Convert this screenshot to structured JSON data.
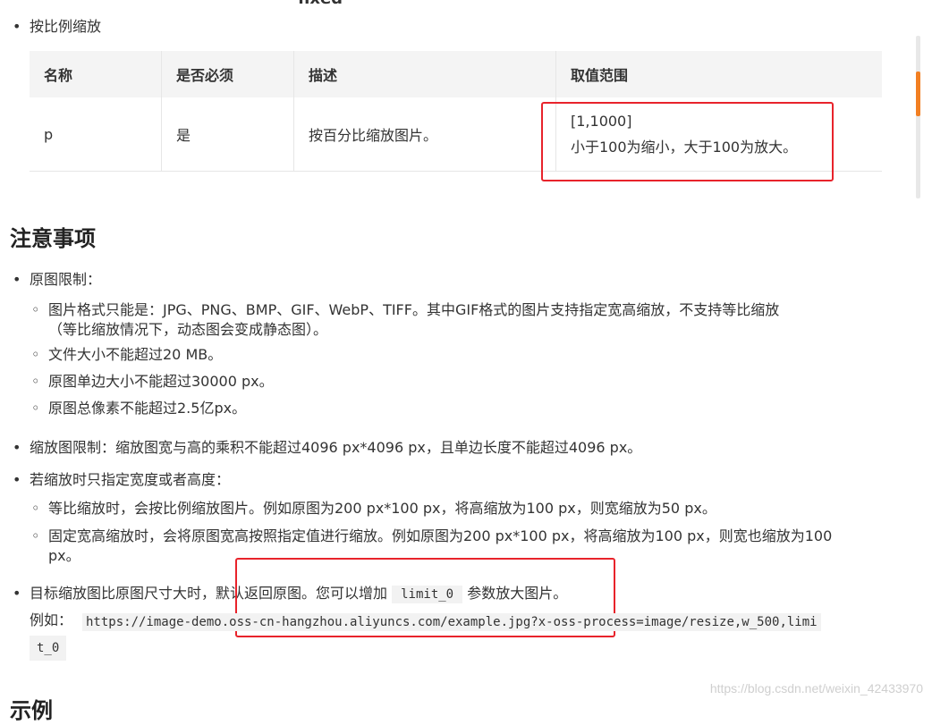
{
  "top_fragment": "fixed",
  "intro_bullet": "按比例缩放",
  "params_table": {
    "headers": [
      "名称",
      "是否必须",
      "描述",
      "取值范围"
    ],
    "row": {
      "name": "p",
      "required": "是",
      "desc": "按百分比缩放图片。",
      "range_line1": "[1,1000]",
      "range_line2": "小于100为缩小，大于100为放大。"
    }
  },
  "notes_heading": "注意事项",
  "notes": {
    "original_limits": "原图限制：",
    "sub_format_line1": "图片格式只能是：JPG、PNG、BMP、GIF、WebP、TIFF。其中GIF格式的图片支持指定宽高缩放，不支持等比缩放",
    "sub_format_line2": "（等比缩放情况下，动态图会变成静态图）。",
    "sub_size": "文件大小不能超过20 MB。",
    "sub_side": "原图单边大小不能超过30000 px。",
    "sub_pixels": "原图总像素不能超过2.5亿px。",
    "scaled_limit": "缩放图限制：缩放图宽与高的乘积不能超过4096 px*4096 px，且单边长度不能超过4096 px。",
    "only_width_height": "若缩放时只指定宽度或者高度：",
    "sub_proportional": "等比缩放时，会按比例缩放图片。例如原图为200 px*100 px，将高缩放为100 px，则宽缩放为50 px。",
    "sub_fixed_line1": "固定宽高缩放时，会将原图宽高按照指定值进行缩放。例如原图为200 px*100 px，将高缩放为100 px，则宽也缩放为100",
    "sub_fixed_line2": "px。",
    "target_larger_prefix": "目标缩放图比原图尺寸大时，默认返回原图。您可以增加",
    "target_larger_code": "limit_0",
    "target_larger_suffix": "参数放大图片。",
    "example_label": "例如：",
    "example_url_line1": "https://image-demo.oss-cn-hangzhou.aliyuncs.com/example.jpg?x-oss-process=image/resize,w_500,limi",
    "example_url_line2": "t_0"
  },
  "next_heading_fragment": "示例",
  "watermark": "https://blog.csdn.net/weixin_42433970",
  "colors": {
    "highlight": "#e8232b",
    "scroll_thumb": "#f27f22",
    "header_bg": "#f4f4f4"
  }
}
